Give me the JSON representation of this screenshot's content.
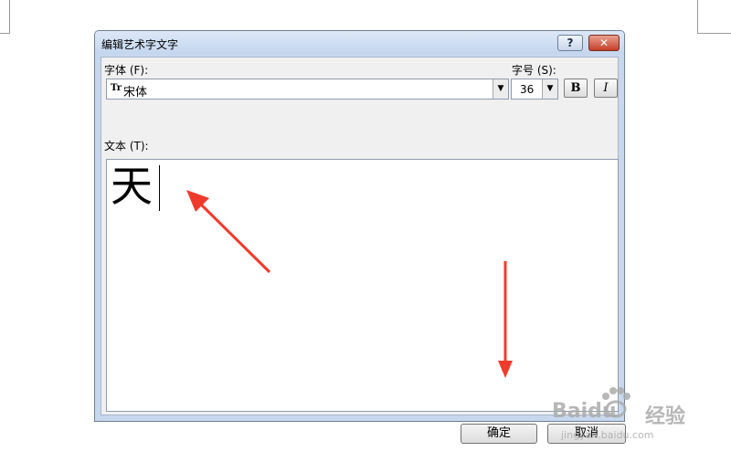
{
  "dialog": {
    "title": "编辑艺术字文字",
    "help_label": "?",
    "close_label": "✕",
    "font_label": "字体 (F):",
    "font_value": "宋体",
    "font_type_icon": "truetype-icon",
    "size_label": "字号 (S):",
    "size_value": "36",
    "bold_label": "B",
    "italic_label": "I",
    "text_label": "文本 (T):",
    "text_value": "天",
    "ok_label": "确定",
    "cancel_label": "取消"
  },
  "annotations": {
    "arrow_color": "#f03a2c"
  },
  "watermark": {
    "brand": "Baidu",
    "product": "经验",
    "url": "jingyan.baidu.com"
  }
}
